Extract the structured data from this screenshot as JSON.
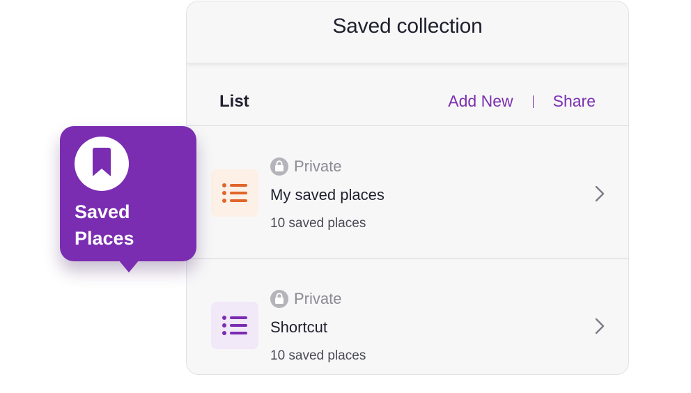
{
  "badge": {
    "line1": "Saved",
    "line2": "Places",
    "icon": "bookmark-icon",
    "color": "#7a2db1"
  },
  "card": {
    "title": "Saved collection"
  },
  "list_bar": {
    "label": "List",
    "add_new": "Add New",
    "share": "Share",
    "accent": "#7b2fb0"
  },
  "rows": [
    {
      "privacy": "Private",
      "title": "My saved places",
      "count": "10 saved places",
      "icon": "list-icon",
      "icon_color": "#e0652a",
      "icon_bg": "#fdf0e6"
    },
    {
      "privacy": "Private",
      "title": "Shortcut",
      "count": "10 saved places",
      "icon": "list-icon",
      "icon_color": "#7a2db1",
      "icon_bg": "#f1e8f8"
    }
  ]
}
